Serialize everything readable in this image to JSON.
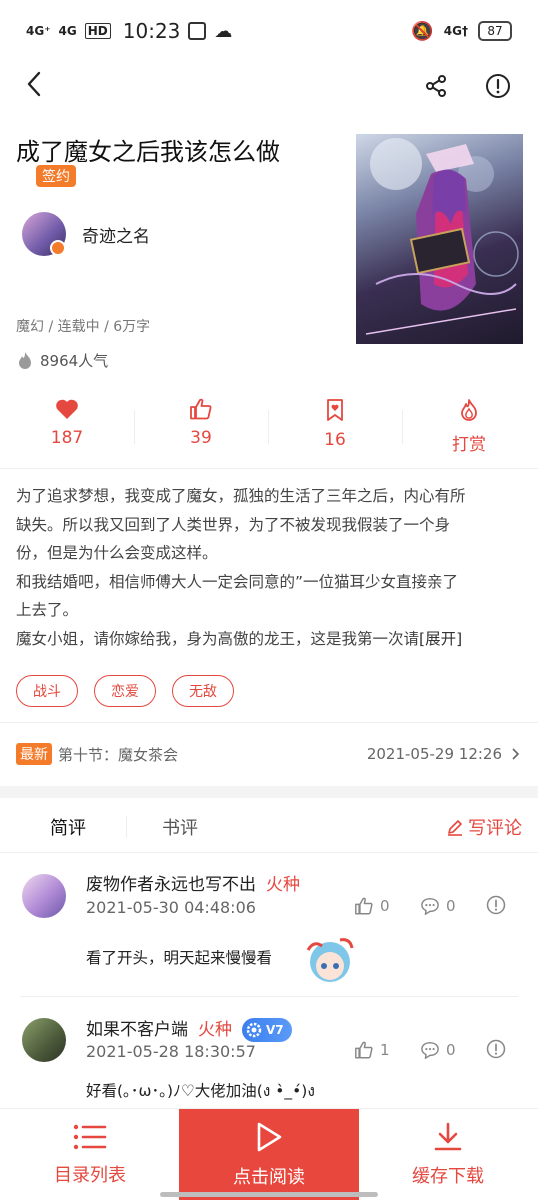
{
  "status_bar": {
    "signal1": "4G⁺",
    "signal2": "4G",
    "hd_label": "HD",
    "time": "10:23",
    "net": "4G†",
    "battery": "87"
  },
  "book": {
    "title": "成了魔女之后我该怎么做",
    "sign_badge": "签约",
    "author": "奇迹之名",
    "meta": "魔幻 / 连载中 / 6万字",
    "popularity": "8964人气"
  },
  "stats": {
    "likes": "187",
    "thumbs": "39",
    "bookmarks": "16",
    "reward": "打赏"
  },
  "synopsis": {
    "lines": [
      "为了追求梦想，我变成了魔女，孤独的生活了三年之后，内心有所",
      "缺失。所以我又回到了人类世界，为了不被发现我假装了一个身",
      "份，但是为什么会变成这样。",
      "和我结婚吧，相信师傅大人一定会同意的”一位猫耳少女直接亲了",
      "上去了。",
      "魔女小姐，请你嫁给我，身为高傲的龙王，这是我第一次请"
    ],
    "expand": "[展开]"
  },
  "tags": [
    "战斗",
    "恋爱",
    "无敌"
  ],
  "latest": {
    "badge": "最新",
    "chapter": "第十节：魔女茶会",
    "time": "2021-05-29 12:26"
  },
  "review_tabs": {
    "short": "简评",
    "book": "书评",
    "write": "写评论"
  },
  "comments": [
    {
      "name": "废物作者永远也写不出",
      "rank": "火种",
      "date": "2021-05-30 04:48:06",
      "likes": "0",
      "replies": "0",
      "text": "看了开头，明天起来慢慢看"
    },
    {
      "name": "如果不客户端",
      "rank": "火种",
      "vip": "V7",
      "date": "2021-05-28 18:30:57",
      "likes": "1",
      "replies": "0",
      "text": "好看(｡･ω･｡)ﾉ♡大佬加油(ง •̀_•́)ง"
    }
  ],
  "bottom_bar": {
    "catalog": "目录列表",
    "read": "点击阅读",
    "download": "缓存下载"
  },
  "colors": {
    "accent": "#e5483f",
    "orange": "#f47b2a"
  }
}
